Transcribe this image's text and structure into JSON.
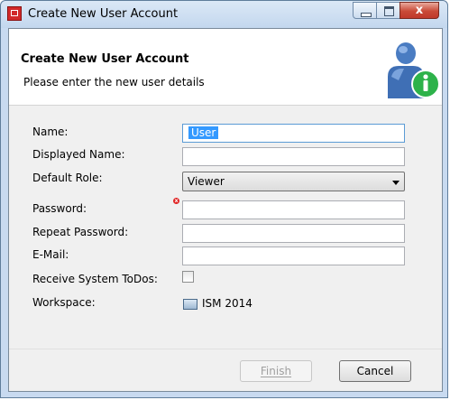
{
  "window": {
    "title": "Create New User Account",
    "controls": {
      "minimize": "",
      "maximize": "",
      "close": "x"
    }
  },
  "banner": {
    "title": "Create New User Account",
    "subtitle": "Please enter the new user details",
    "icon": "user-info-icon"
  },
  "form": {
    "name_label": "Name:",
    "name_value": "User",
    "displayed_name_label": "Displayed Name:",
    "displayed_name_value": "",
    "default_role_label": "Default Role:",
    "default_role_value": "Viewer",
    "password_label": "Password:",
    "password_value": "",
    "repeat_password_label": "Repeat Password:",
    "repeat_password_value": "",
    "email_label": "E-Mail:",
    "email_value": "",
    "receive_todos_label": "Receive System ToDos:",
    "receive_todos_checked": false,
    "workspace_label": "Workspace:",
    "workspace_value": "ISM 2014"
  },
  "buttons": {
    "finish_label": "Finish",
    "cancel_label": "Cancel"
  },
  "colors": {
    "title_bar": "#c3d7ee",
    "close_button": "#c94a37",
    "selection": "#3399ff",
    "error_marker": "#e02424",
    "info_badge": "#2db24a",
    "user_icon_body": "#3f6fb5"
  }
}
